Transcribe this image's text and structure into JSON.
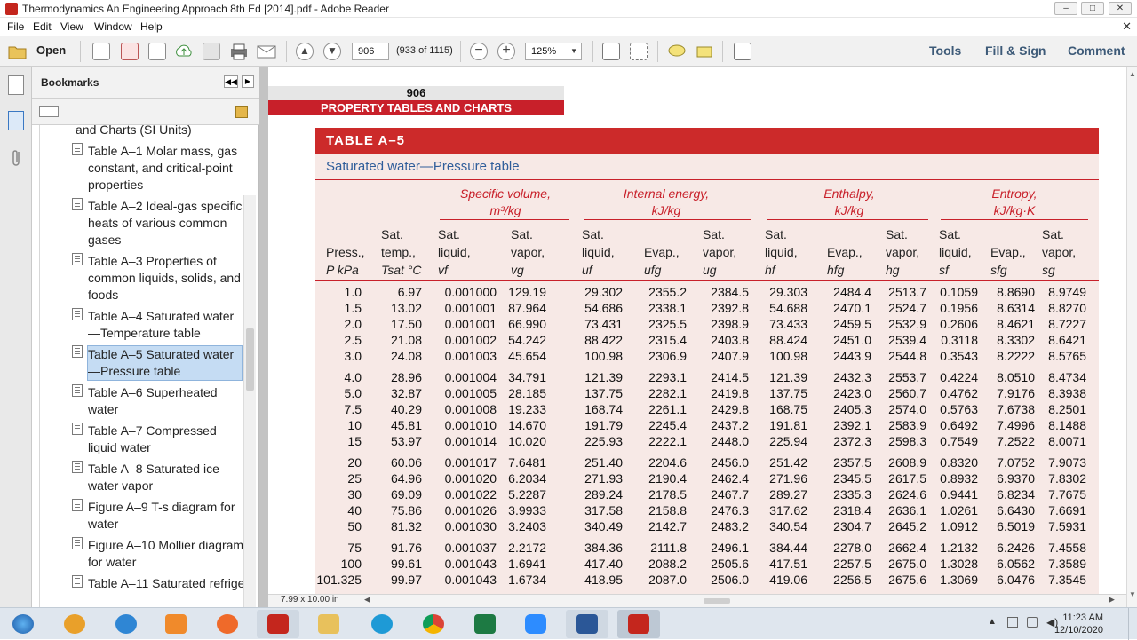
{
  "window": {
    "title": "Thermodynamics An Engineering Approach 8th Ed [2014].pdf - Adobe Reader",
    "controls": [
      "–",
      "□",
      "✕"
    ]
  },
  "menu": [
    "File",
    "Edit",
    "View",
    "Window",
    "Help"
  ],
  "toolbar": {
    "open_label": "Open",
    "page_value": "906",
    "page_count": "(933 of 1115)",
    "zoom_value": "125%",
    "tools_label": "Tools",
    "fillsign_label": "Fill & Sign",
    "comment_label": "Comment"
  },
  "bookmarks": {
    "title": "Bookmarks",
    "partial_item": "and Charts (SI Units)",
    "items": [
      {
        "label": "Table A–1 Molar mass, gas constant, and critical-point properties"
      },
      {
        "label": "Table A–2 Ideal-gas specific heats of various common gases"
      },
      {
        "label": "Table A–3 Properties of common liquids, solids, and foods"
      },
      {
        "label": "Table A–4 Saturated water—Temperature table"
      },
      {
        "label": "Table A–5 Saturated water—Pressure table",
        "selected": true
      },
      {
        "label": "Table A–6 Superheated water"
      },
      {
        "label": "Table A–7 Compressed liquid water"
      },
      {
        "label": "Table A–8 Saturated ice–water vapor"
      },
      {
        "label": "Figure A–9 T-s diagram for water"
      },
      {
        "label": "Figure A–10 Mollier diagram for water"
      },
      {
        "label": "Table A–11 Saturated refrigerant-134a—Tempera"
      }
    ]
  },
  "page": {
    "number": "906",
    "section": "PROPERTY TABLES AND CHARTS",
    "page_size": "7.99 x 10.00 in"
  },
  "table": {
    "title": "TABLE A–5",
    "subtitle": "Saturated water—Pressure table",
    "groups": [
      {
        "line1": "Specific volume,",
        "line2": "m³/kg"
      },
      {
        "line1": "Internal energy,",
        "line2": "kJ/kg"
      },
      {
        "line1": "Enthalpy,",
        "line2": "kJ/kg"
      },
      {
        "line1": "Entropy,",
        "line2": "kJ/kg·K"
      }
    ],
    "columns": [
      [
        "",
        "Press.,",
        "P kPa"
      ],
      [
        "Sat.",
        "temp.,",
        "Tsat °C"
      ],
      [
        "Sat.",
        "liquid,",
        "vf"
      ],
      [
        "Sat.",
        "vapor,",
        "vg"
      ],
      [
        "Sat.",
        "liquid,",
        "uf"
      ],
      [
        "",
        "Evap.,",
        "ufg"
      ],
      [
        "Sat.",
        "vapor,",
        "ug"
      ],
      [
        "Sat.",
        "liquid,",
        "hf"
      ],
      [
        "",
        "Evap.,",
        "hfg"
      ],
      [
        "Sat.",
        "vapor,",
        "hg"
      ],
      [
        "Sat.",
        "liquid,",
        "sf"
      ],
      [
        "",
        "Evap.,",
        "sfg"
      ],
      [
        "Sat.",
        "vapor,",
        "sg"
      ]
    ],
    "rows": [
      [
        "1.0",
        "6.97",
        "0.001000",
        "129.19",
        "29.302",
        "2355.2",
        "2384.5",
        "29.303",
        "2484.4",
        "2513.7",
        "0.1059",
        "8.8690",
        "8.9749"
      ],
      [
        "1.5",
        "13.02",
        "0.001001",
        "87.964",
        "54.686",
        "2338.1",
        "2392.8",
        "54.688",
        "2470.1",
        "2524.7",
        "0.1956",
        "8.6314",
        "8.8270"
      ],
      [
        "2.0",
        "17.50",
        "0.001001",
        "66.990",
        "73.431",
        "2325.5",
        "2398.9",
        "73.433",
        "2459.5",
        "2532.9",
        "0.2606",
        "8.4621",
        "8.7227"
      ],
      [
        "2.5",
        "21.08",
        "0.001002",
        "54.242",
        "88.422",
        "2315.4",
        "2403.8",
        "88.424",
        "2451.0",
        "2539.4",
        "0.3118",
        "8.3302",
        "8.6421"
      ],
      [
        "3.0",
        "24.08",
        "0.001003",
        "45.654",
        "100.98",
        "2306.9",
        "2407.9",
        "100.98",
        "2443.9",
        "2544.8",
        "0.3543",
        "8.2222",
        "8.5765"
      ],
      [
        "4.0",
        "28.96",
        "0.001004",
        "34.791",
        "121.39",
        "2293.1",
        "2414.5",
        "121.39",
        "2432.3",
        "2553.7",
        "0.4224",
        "8.0510",
        "8.4734"
      ],
      [
        "5.0",
        "32.87",
        "0.001005",
        "28.185",
        "137.75",
        "2282.1",
        "2419.8",
        "137.75",
        "2423.0",
        "2560.7",
        "0.4762",
        "7.9176",
        "8.3938"
      ],
      [
        "7.5",
        "40.29",
        "0.001008",
        "19.233",
        "168.74",
        "2261.1",
        "2429.8",
        "168.75",
        "2405.3",
        "2574.0",
        "0.5763",
        "7.6738",
        "8.2501"
      ],
      [
        "10",
        "45.81",
        "0.001010",
        "14.670",
        "191.79",
        "2245.4",
        "2437.2",
        "191.81",
        "2392.1",
        "2583.9",
        "0.6492",
        "7.4996",
        "8.1488"
      ],
      [
        "15",
        "53.97",
        "0.001014",
        "10.020",
        "225.93",
        "2222.1",
        "2448.0",
        "225.94",
        "2372.3",
        "2598.3",
        "0.7549",
        "7.2522",
        "8.0071"
      ],
      [
        "20",
        "60.06",
        "0.001017",
        "7.6481",
        "251.40",
        "2204.6",
        "2456.0",
        "251.42",
        "2357.5",
        "2608.9",
        "0.8320",
        "7.0752",
        "7.9073"
      ],
      [
        "25",
        "64.96",
        "0.001020",
        "6.2034",
        "271.93",
        "2190.4",
        "2462.4",
        "271.96",
        "2345.5",
        "2617.5",
        "0.8932",
        "6.9370",
        "7.8302"
      ],
      [
        "30",
        "69.09",
        "0.001022",
        "5.2287",
        "289.24",
        "2178.5",
        "2467.7",
        "289.27",
        "2335.3",
        "2624.6",
        "0.9441",
        "6.8234",
        "7.7675"
      ],
      [
        "40",
        "75.86",
        "0.001026",
        "3.9933",
        "317.58",
        "2158.8",
        "2476.3",
        "317.62",
        "2318.4",
        "2636.1",
        "1.0261",
        "6.6430",
        "7.6691"
      ],
      [
        "50",
        "81.32",
        "0.001030",
        "3.2403",
        "340.49",
        "2142.7",
        "2483.2",
        "340.54",
        "2304.7",
        "2645.2",
        "1.0912",
        "6.5019",
        "7.5931"
      ],
      [
        "75",
        "91.76",
        "0.001037",
        "2.2172",
        "384.36",
        "2111.8",
        "2496.1",
        "384.44",
        "2278.0",
        "2662.4",
        "1.2132",
        "6.2426",
        "7.4558"
      ],
      [
        "100",
        "99.61",
        "0.001043",
        "1.6941",
        "417.40",
        "2088.2",
        "2505.6",
        "417.51",
        "2257.5",
        "2675.0",
        "1.3028",
        "6.0562",
        "7.3589"
      ],
      [
        "101.325",
        "99.97",
        "0.001043",
        "1.6734",
        "418.95",
        "2087.0",
        "2506.0",
        "419.06",
        "2256.5",
        "2675.6",
        "1.3069",
        "6.0476",
        "7.3545"
      ]
    ]
  },
  "taskbar": {
    "time": "11:23 AM",
    "date": "12/10/2020",
    "apps": [
      "start",
      "chrome-alt",
      "internet-explorer",
      "media-player",
      "firefox",
      "acrobat",
      "file-explorer",
      "edge",
      "chrome",
      "excel",
      "zoom",
      "word",
      "adobe-reader"
    ]
  },
  "colors": {
    "accent_red": "#c8202a",
    "table_bg": "#f7e9e6",
    "subtitle_blue": "#2f5d9a",
    "bookmark_selected": "#c5dcf3"
  }
}
